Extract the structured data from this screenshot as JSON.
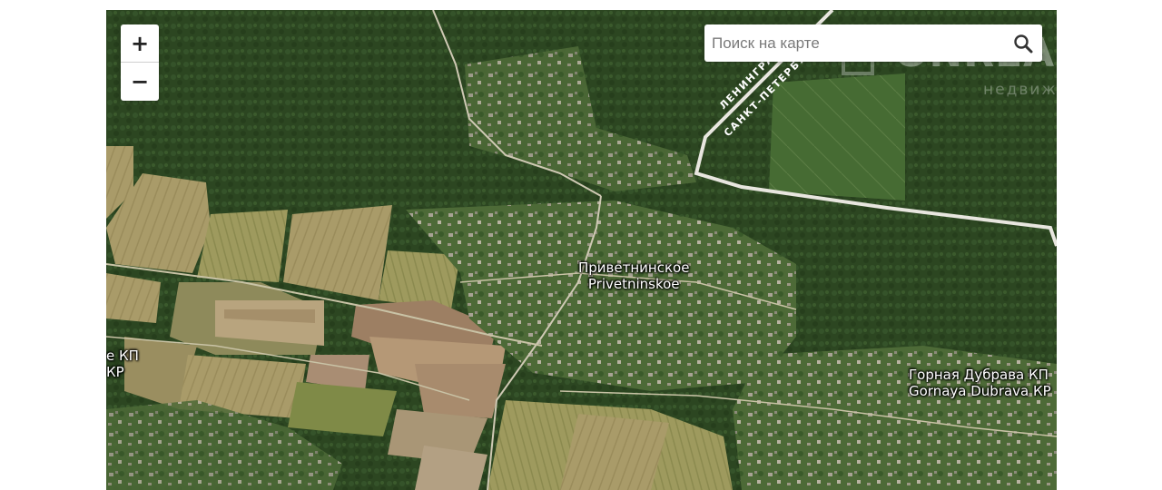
{
  "map": {
    "zoom_in_label": "+",
    "zoom_out_label": "−",
    "search": {
      "placeholder": "Поиск на карте"
    },
    "search_icon": "magnifier-icon",
    "watermark": {
      "name": "ONREALT",
      "subtitle": "недвижимость"
    },
    "roads": [
      {
        "label": "ЛЕНИНГРАДСКА"
      },
      {
        "label": "САНКТ-ПЕТЕРБУРГ"
      }
    ],
    "places": [
      {
        "name_ru": "Приветнинское",
        "name_en": "Privetninskoe"
      },
      {
        "name_ru": "е КП",
        "name_en": "КР"
      },
      {
        "name_ru": "Горная Дубрава КП",
        "name_en": "Gornaya Dubrava КР"
      }
    ],
    "colors": {
      "forest": "#2f4a22",
      "field": "#a89c6a",
      "road": "#e8e6df"
    }
  }
}
